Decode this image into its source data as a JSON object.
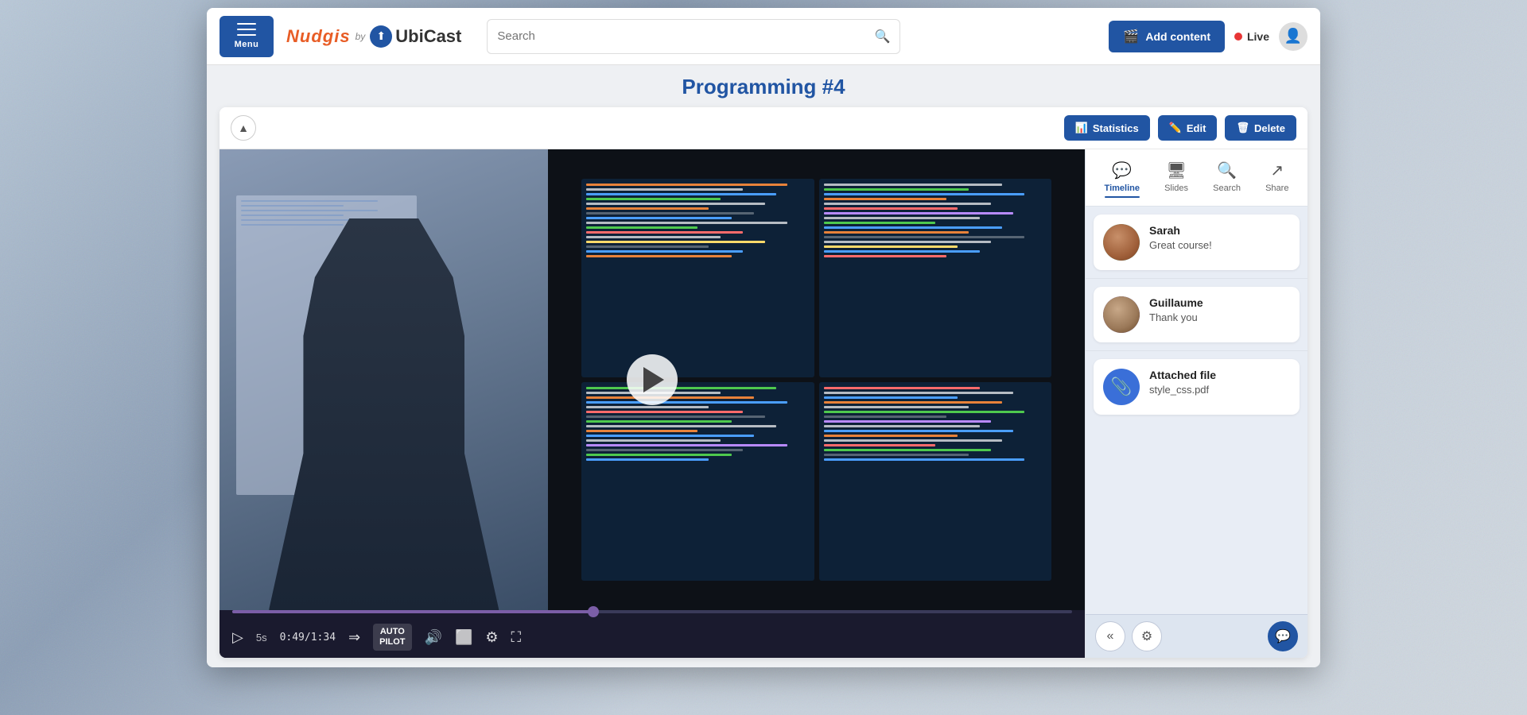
{
  "navbar": {
    "menu_label": "Menu",
    "logo_nudgis": "Nudgis",
    "logo_by": "by",
    "logo_ubicast": "UbiCast",
    "search_placeholder": "Search",
    "add_content_label": "Add content",
    "live_label": "Live"
  },
  "page": {
    "title": "Programming #4"
  },
  "toolbar": {
    "statistics_label": "Statistics",
    "edit_label": "Edit",
    "delete_label": "Delete"
  },
  "player": {
    "skip_label": "5s",
    "time_current": "0:49",
    "time_total": "1:34",
    "autopilot_label": "AUTO\nPILOT",
    "progress_percent": 43
  },
  "tabs": [
    {
      "id": "timeline",
      "label": "Timeline",
      "active": true
    },
    {
      "id": "slides",
      "label": "Slides",
      "active": false
    },
    {
      "id": "search",
      "label": "Search",
      "active": false
    },
    {
      "id": "share",
      "label": "Share",
      "active": false
    }
  ],
  "chat": {
    "messages": [
      {
        "id": "msg1",
        "author": "Sarah",
        "text": "Great course!",
        "avatar_type": "sarah"
      },
      {
        "id": "msg2",
        "author": "Guillaume",
        "text": "Thank you",
        "avatar_type": "guillaume"
      }
    ],
    "attachment": {
      "label": "Attached file",
      "filename": "style_css.pdf"
    }
  },
  "bottom_bar": {
    "back_icon": "«",
    "settings_icon": "⚙",
    "chat_icon": "💬"
  }
}
